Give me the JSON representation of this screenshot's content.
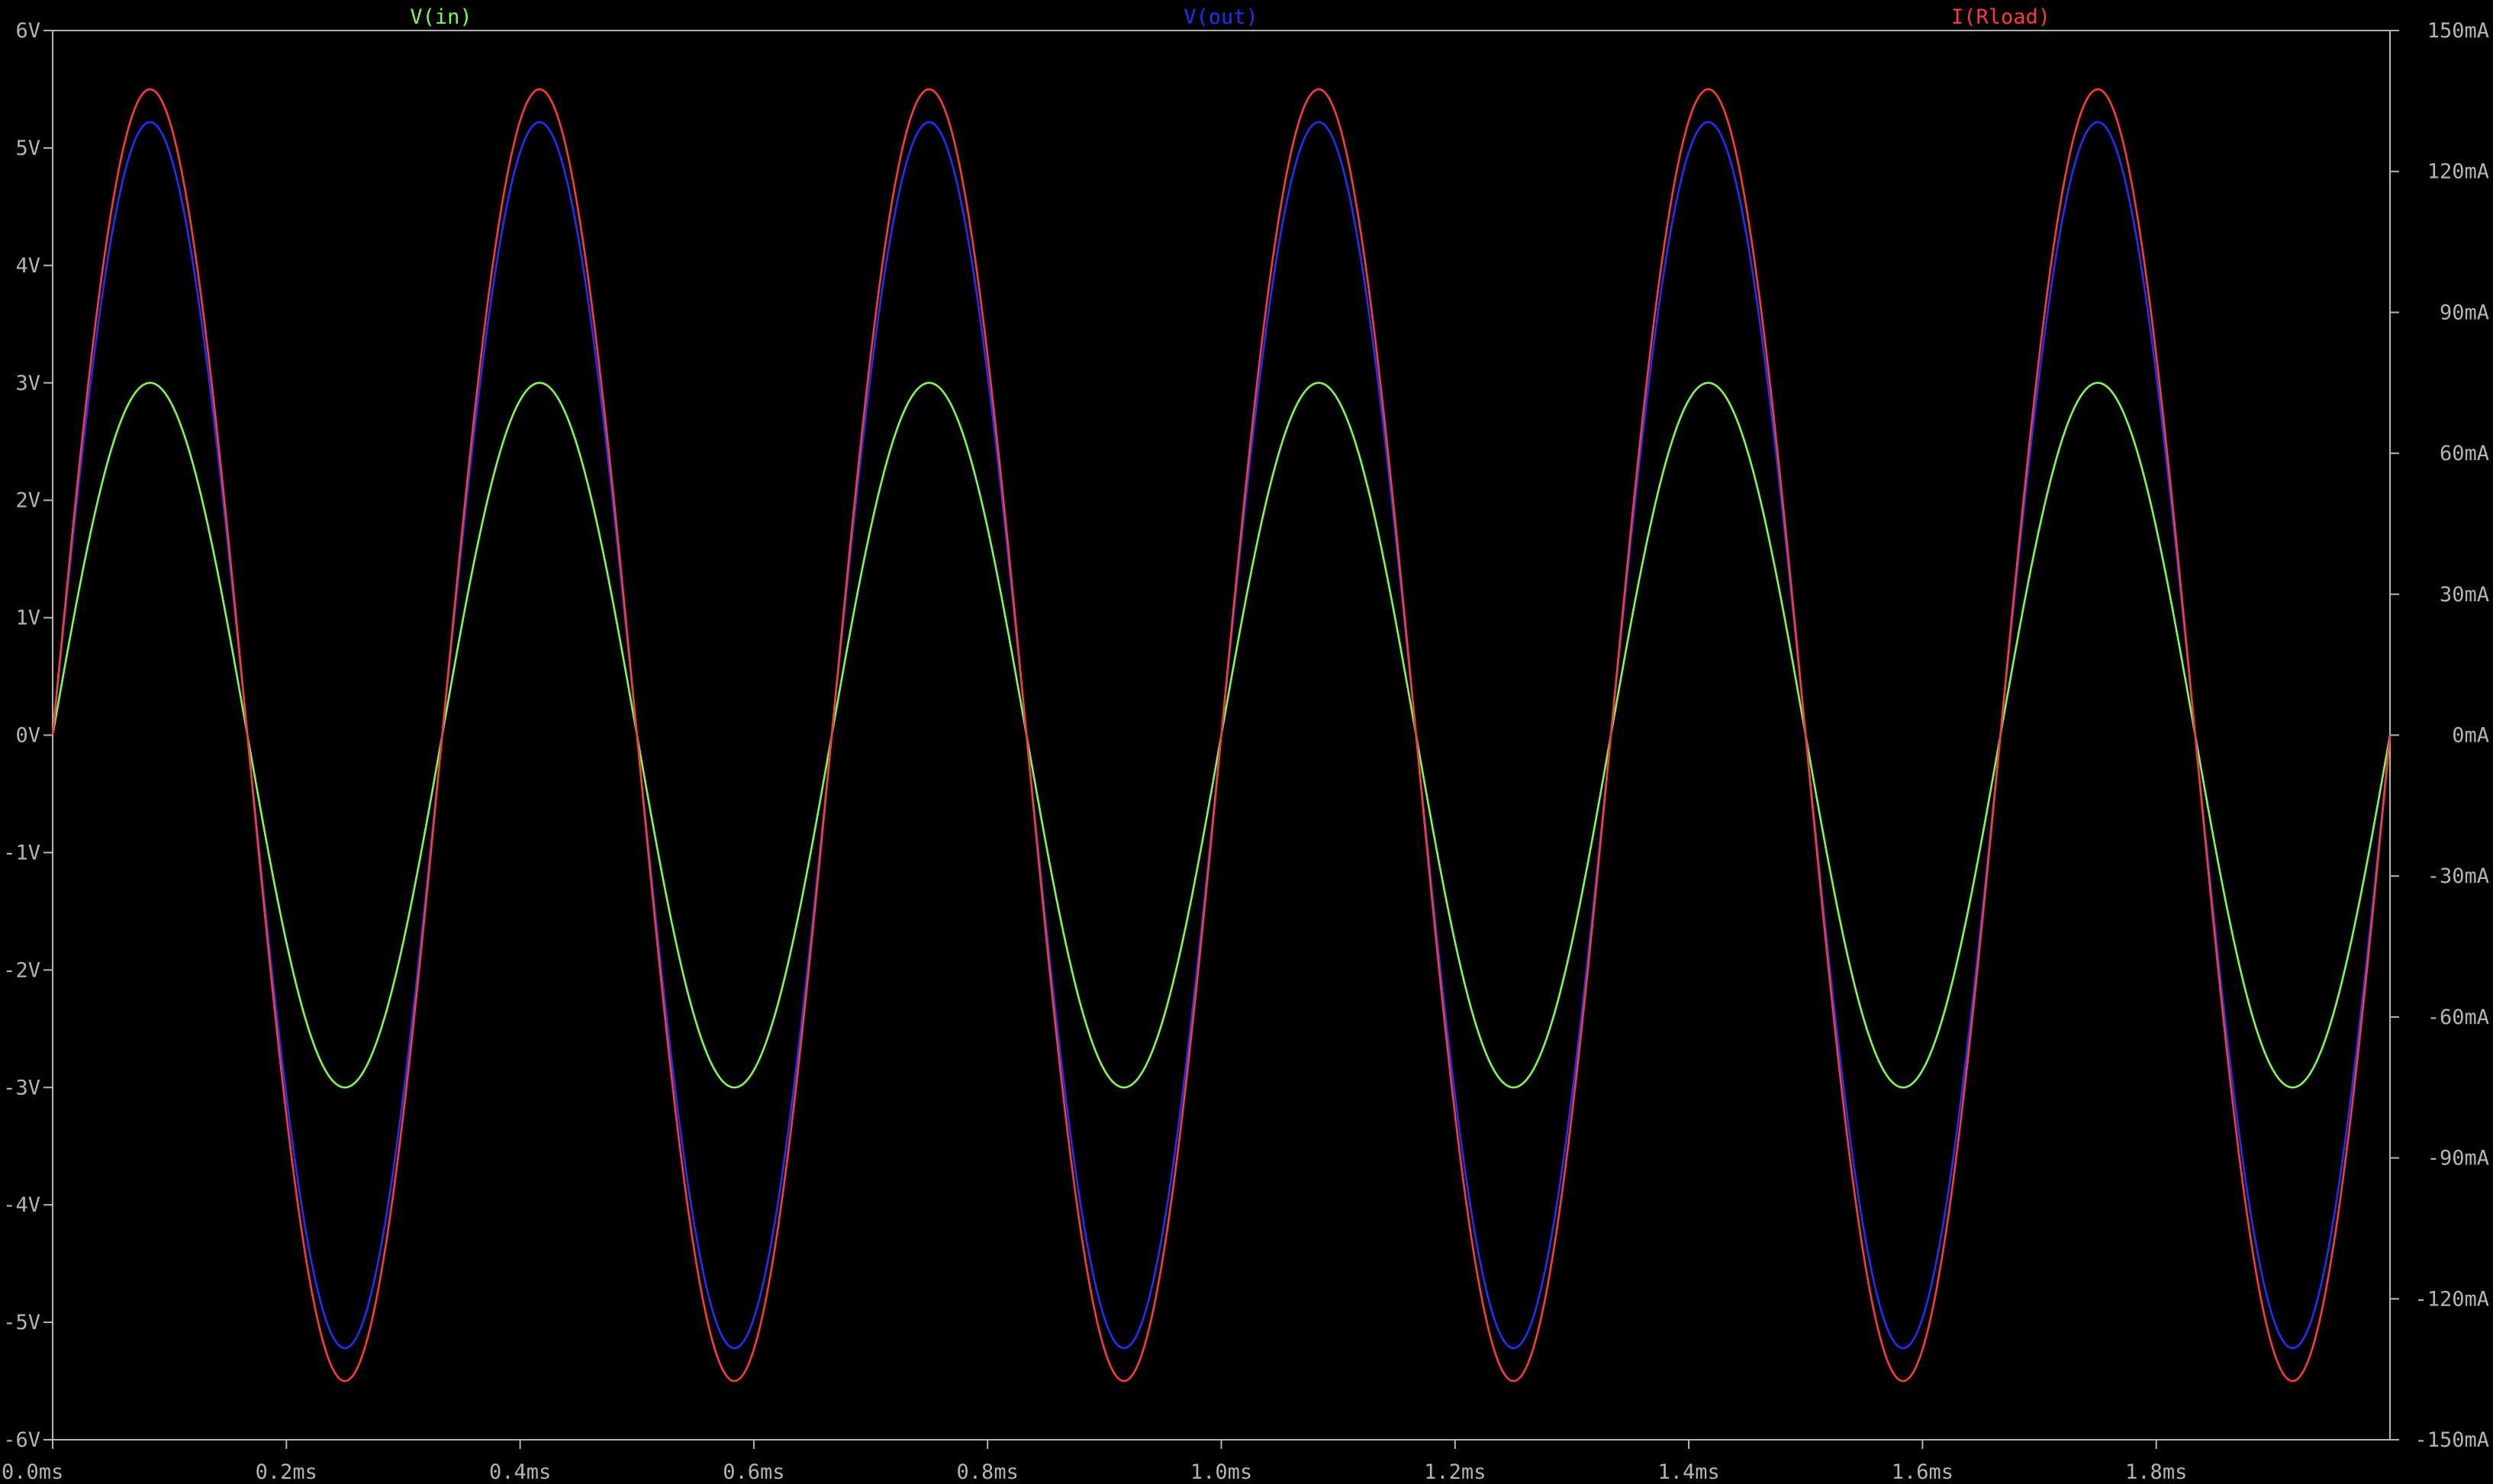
{
  "chart_data": {
    "type": "line",
    "x": {
      "unit": "ms",
      "range": [
        0,
        2.0
      ],
      "ticks": [
        "0.0ms",
        "0.2ms",
        "0.4ms",
        "0.6ms",
        "0.8ms",
        "1.0ms",
        "1.2ms",
        "1.4ms",
        "1.6ms",
        "1.8ms"
      ],
      "tick_values": [
        0,
        0.2,
        0.4,
        0.6,
        0.8,
        1.0,
        1.2,
        1.4,
        1.6,
        1.8
      ]
    },
    "y_left": {
      "unit": "V",
      "range": [
        -6,
        6
      ],
      "ticks": [
        "6V",
        "5V",
        "4V",
        "3V",
        "2V",
        "1V",
        "0V",
        "-1V",
        "-2V",
        "-3V",
        "-4V",
        "-5V",
        "-6V"
      ],
      "tick_values": [
        6,
        5,
        4,
        3,
        2,
        1,
        0,
        -1,
        -2,
        -3,
        -4,
        -5,
        -6
      ]
    },
    "y_right": {
      "unit": "mA",
      "range": [
        -150,
        150
      ],
      "ticks": [
        "150mA",
        "120mA",
        "90mA",
        "60mA",
        "30mA",
        "0mA",
        "-30mA",
        "-60mA",
        "-90mA",
        "-120mA",
        "-150mA"
      ],
      "tick_values": [
        150,
        120,
        90,
        60,
        30,
        0,
        -30,
        -60,
        -90,
        -120,
        -150
      ]
    },
    "grid": false,
    "legend_position": "top",
    "series": [
      {
        "name": "V(in)",
        "axis": "left",
        "color": "#7cfc4c",
        "shape": "sine",
        "amplitude": 3.0,
        "frequency_khz": 3.0,
        "phase_deg": 0
      },
      {
        "name": "V(out)",
        "axis": "left",
        "color": "#1f2fff",
        "shape": "sine",
        "amplitude": 5.22,
        "frequency_khz": 3.0,
        "phase_deg": 0
      },
      {
        "name": "I(Rload)",
        "axis": "right",
        "color": "#ff3b30",
        "shape": "sine",
        "amplitude": 137.5,
        "frequency_khz": 3.0,
        "phase_deg": 0
      }
    ]
  },
  "colors": {
    "background": "#000000",
    "axis": "#b4b4b4",
    "text": "#b4b4b4"
  }
}
